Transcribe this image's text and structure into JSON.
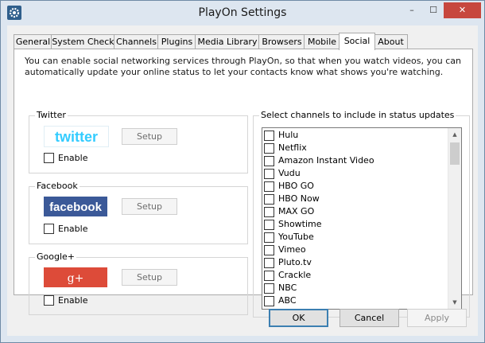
{
  "window": {
    "title": "PlayOn Settings",
    "minimize": "–",
    "maximize": "☐",
    "close": "✕"
  },
  "tabs": [
    {
      "label": "General"
    },
    {
      "label": "System Check"
    },
    {
      "label": "Channels"
    },
    {
      "label": "Plugins"
    },
    {
      "label": "Media Library"
    },
    {
      "label": "Browsers"
    },
    {
      "label": "Mobile"
    },
    {
      "label": "Social",
      "active": true
    },
    {
      "label": "About"
    }
  ],
  "social": {
    "intro": "You can enable social networking services through PlayOn, so that when you watch videos, you can automatically update your online status to let your contacts know what shows you're watching.",
    "twitter": {
      "label": "Twitter",
      "logo": "twitter",
      "setup": "Setup",
      "enable": "Enable",
      "color": "#33ccff"
    },
    "facebook": {
      "label": "Facebook",
      "logo": "facebook",
      "setup": "Setup",
      "enable": "Enable",
      "color": "#3b5998"
    },
    "googleplus": {
      "label": "Google+",
      "logo": "g+",
      "setup": "Setup",
      "enable": "Enable",
      "color": "#dd4b39"
    },
    "channels_label": "Select channels to include in status updates",
    "channels": [
      "Hulu",
      "Netflix",
      "Amazon Instant Video",
      "Vudu",
      "HBO GO",
      "HBO Now",
      "MAX GO",
      "Showtime",
      "YouTube",
      "Vimeo",
      "Pluto.tv",
      "Crackle",
      "NBC",
      "ABC"
    ]
  },
  "buttons": {
    "ok": "OK",
    "cancel": "Cancel",
    "apply": "Apply"
  },
  "scroll": {
    "up": "▲",
    "down": "▼"
  }
}
